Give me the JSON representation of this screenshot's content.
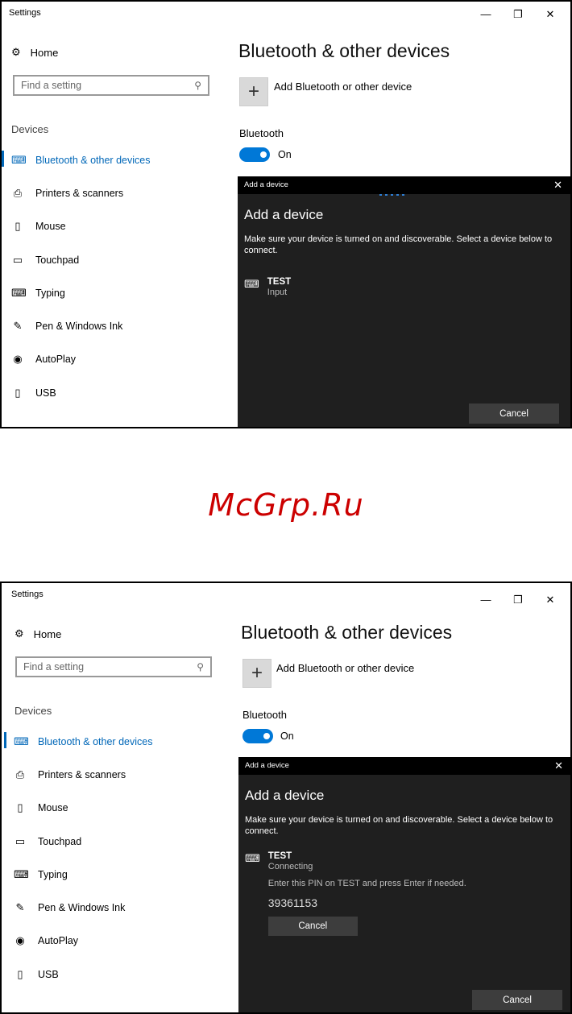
{
  "watermark": "McGrp.Ru",
  "screens": [
    {
      "window_title": "Settings",
      "win_controls": [
        "—",
        "❐",
        "✕"
      ],
      "home_label": "Home",
      "search_placeholder": "Find a setting",
      "group_label": "Devices",
      "nav": [
        {
          "label": "Bluetooth & other devices",
          "icon": "bluetooth-devices-icon",
          "active": true
        },
        {
          "label": "Printers & scanners",
          "icon": "printer-icon"
        },
        {
          "label": "Mouse",
          "icon": "mouse-icon"
        },
        {
          "label": "Touchpad",
          "icon": "touchpad-icon"
        },
        {
          "label": "Typing",
          "icon": "keyboard-icon"
        },
        {
          "label": "Pen & Windows Ink",
          "icon": "pen-icon"
        },
        {
          "label": "AutoPlay",
          "icon": "autoplay-icon"
        },
        {
          "label": "USB",
          "icon": "usb-icon"
        }
      ],
      "page_title": "Bluetooth & other devices",
      "add_label": "Add Bluetooth or other device",
      "bluetooth_label": "Bluetooth",
      "toggle_state": "On",
      "dialog": {
        "title": "Add a device",
        "heading": "Add a device",
        "text": "Make sure your device is turned on and discoverable. Select a device below to connect.",
        "device_name": "TEST",
        "device_status": "Input",
        "cancel_label": "Cancel"
      }
    },
    {
      "window_title": "Settings",
      "win_controls": [
        "—",
        "❐",
        "✕"
      ],
      "home_label": "Home",
      "search_placeholder": "Find a setting",
      "group_label": "Devices",
      "nav": [
        {
          "label": "Bluetooth & other devices",
          "icon": "bluetooth-devices-icon",
          "active": true
        },
        {
          "label": "Printers & scanners",
          "icon": "printer-icon"
        },
        {
          "label": "Mouse",
          "icon": "mouse-icon"
        },
        {
          "label": "Touchpad",
          "icon": "touchpad-icon"
        },
        {
          "label": "Typing",
          "icon": "keyboard-icon"
        },
        {
          "label": "Pen & Windows Ink",
          "icon": "pen-icon"
        },
        {
          "label": "AutoPlay",
          "icon": "autoplay-icon"
        },
        {
          "label": "USB",
          "icon": "usb-icon"
        }
      ],
      "page_title": "Bluetooth & other devices",
      "add_label": "Add Bluetooth or other device",
      "bluetooth_label": "Bluetooth",
      "toggle_state": "On",
      "dialog": {
        "title": "Add a device",
        "heading": "Add a device",
        "text": "Make sure your device is turned on and discoverable. Select a device below to connect.",
        "device_name": "TEST",
        "device_status": "Connecting",
        "pin_message": "Enter this PIN on TEST and press Enter if needed.",
        "pin": "39361153",
        "inline_cancel_label": "Cancel",
        "cancel_label": "Cancel"
      }
    }
  ]
}
